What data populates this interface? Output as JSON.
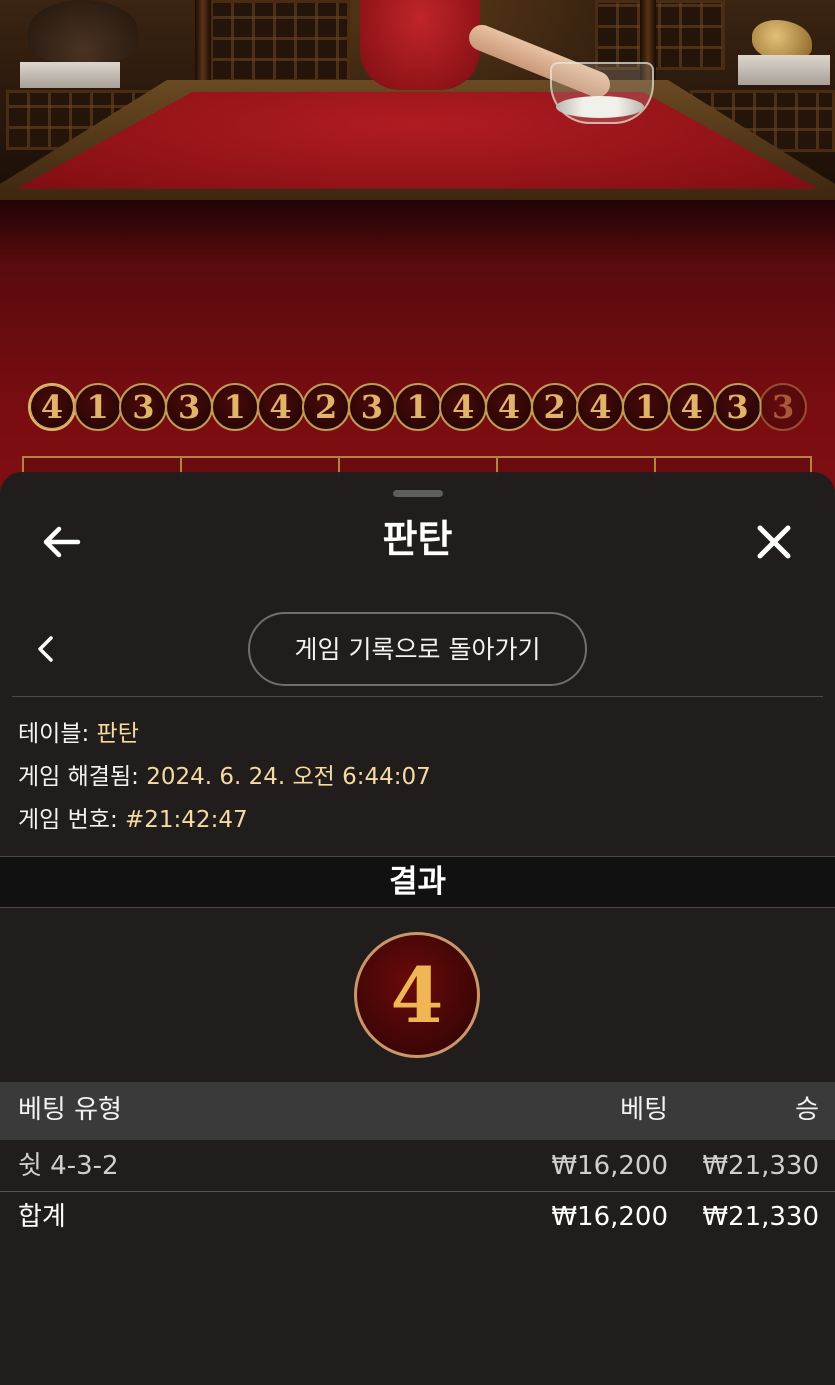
{
  "history_balls": [
    "4",
    "1",
    "3",
    "3",
    "1",
    "4",
    "2",
    "3",
    "1",
    "4",
    "4",
    "2",
    "4",
    "1",
    "4",
    "3",
    "3"
  ],
  "panel": {
    "title": "판탄",
    "back_to_history": "게임 기록으로 돌아가기"
  },
  "info": {
    "table_label": "테이블:",
    "table_value": "판탄",
    "resolved_label": "게임 해결됨:",
    "resolved_value": "2024. 6. 24. 오전 6:44:07",
    "game_no_label": "게임 번호:",
    "game_no_value": "#21:42:47"
  },
  "result": {
    "heading": "결과",
    "number": "4"
  },
  "bets": {
    "headers": {
      "type": "베팅 유형",
      "bet": "베팅",
      "win": "승"
    },
    "rows": [
      {
        "type": "쉿 4-3-2",
        "bet": "₩16,200",
        "win": "₩21,330"
      }
    ],
    "total": {
      "label": "합계",
      "bet": "₩16,200",
      "win": "₩21,330"
    }
  },
  "colors": {
    "accent_gold": "#e0b46b",
    "value_text": "#f5dba2",
    "felt_red": "#8c1015",
    "panel_bg": "#1e1e1e"
  }
}
